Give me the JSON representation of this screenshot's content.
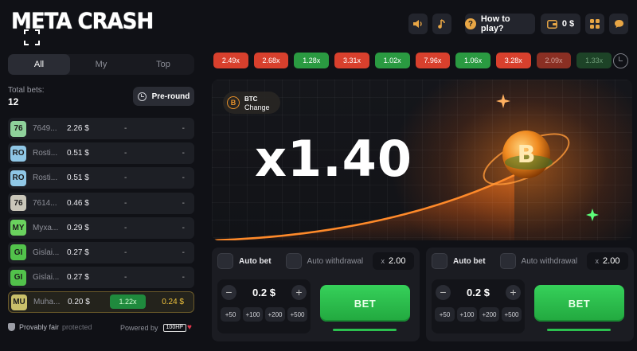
{
  "header": {
    "logo": "META CRASH",
    "how_to_play": "How to play?",
    "help_glyph": "?",
    "balance": "0 $"
  },
  "bets_panel": {
    "tabs": [
      "All",
      "My",
      "Top"
    ],
    "active_tab": "All",
    "total_label": "Total bets:",
    "total_count": "12",
    "preround_label": "Pre-round",
    "rows": [
      {
        "initials": "76",
        "name": "7649...",
        "bet": "2.26 $",
        "mult": "-",
        "win": "-",
        "color": "#8fd19b"
      },
      {
        "initials": "RO",
        "name": "Rosti...",
        "bet": "0.51 $",
        "mult": "-",
        "win": "-",
        "color": "#8fc7e6"
      },
      {
        "initials": "RO",
        "name": "Rosti...",
        "bet": "0.51 $",
        "mult": "-",
        "win": "-",
        "color": "#8fc7e6"
      },
      {
        "initials": "76",
        "name": "7614...",
        "bet": "0.46 $",
        "mult": "-",
        "win": "-",
        "color": "#c9c6b9"
      },
      {
        "initials": "MY",
        "name": "Myxa...",
        "bet": "0.29 $",
        "mult": "-",
        "win": "-",
        "color": "#6ad25e"
      },
      {
        "initials": "GI",
        "name": "Gislai...",
        "bet": "0.27 $",
        "mult": "-",
        "win": "-",
        "color": "#52c24b"
      },
      {
        "initials": "GI",
        "name": "Gislai...",
        "bet": "0.27 $",
        "mult": "-",
        "win": "-",
        "color": "#52c24b"
      },
      {
        "initials": "MU",
        "name": "Muha...",
        "bet": "0.20 $",
        "mult": "1.22x",
        "win": "0.24 $",
        "color": "#c9c06a",
        "winner": true
      }
    ],
    "footer": {
      "provably": "Provably fair",
      "protected": "protected",
      "powered": "Powered by",
      "brand": "100HP"
    }
  },
  "history": [
    {
      "value": "2.49x",
      "tone": "red"
    },
    {
      "value": "2.68x",
      "tone": "red"
    },
    {
      "value": "1.28x",
      "tone": "green"
    },
    {
      "value": "3.31x",
      "tone": "red"
    },
    {
      "value": "1.02x",
      "tone": "green"
    },
    {
      "value": "7.96x",
      "tone": "red"
    },
    {
      "value": "1.06x",
      "tone": "green"
    },
    {
      "value": "3.28x",
      "tone": "red"
    },
    {
      "value": "2.09x",
      "tone": "fade-red"
    },
    {
      "value": "1.33x",
      "tone": "fade-green"
    }
  ],
  "game": {
    "asset_line1": "BTC",
    "asset_line2": "Change",
    "coin_glyph": "B",
    "multiplier": "x1.40"
  },
  "bet_panels": [
    {
      "auto_bet": "Auto bet",
      "auto_withdrawal": "Auto withdrawal",
      "x_label": "x",
      "cashout_mult": "2.00",
      "amount": "0.2 $",
      "quick": [
        "+50",
        "+100",
        "+200",
        "+500"
      ],
      "bet_label": "BET"
    },
    {
      "auto_bet": "Auto bet",
      "auto_withdrawal": "Auto withdrawal",
      "x_label": "x",
      "cashout_mult": "2.00",
      "amount": "0.2 $",
      "quick": [
        "+50",
        "+100",
        "+200",
        "+500"
      ],
      "bet_label": "BET"
    }
  ],
  "colors": {
    "accent_orange": "#ff8a1e",
    "bet_green": "#2cc04f",
    "loss_red": "#d8402d",
    "win_green": "#2a9a41"
  }
}
